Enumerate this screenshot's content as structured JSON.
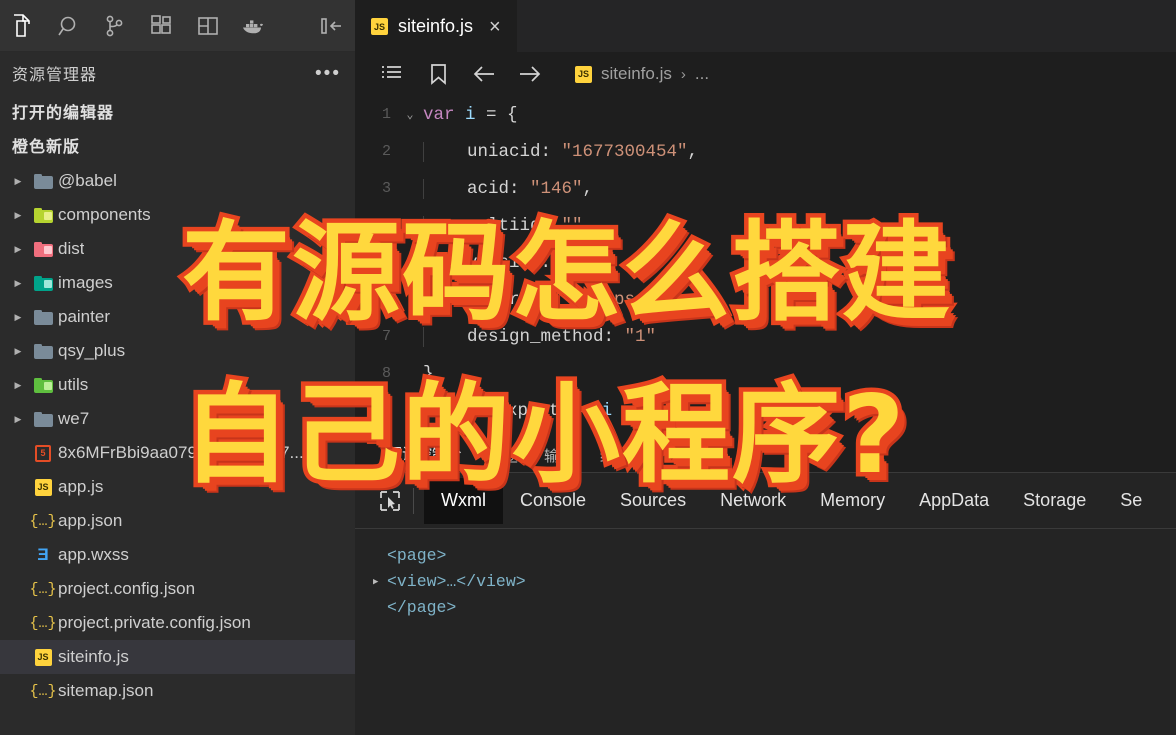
{
  "activitybar": {
    "icons": [
      {
        "name": "explorer-icon",
        "label": "资源管理器",
        "active": true
      },
      {
        "name": "search-icon",
        "label": "搜索",
        "active": false
      },
      {
        "name": "source-control-icon",
        "label": "源代码管理",
        "active": false
      },
      {
        "name": "extensions-icon",
        "label": "扩展",
        "active": false
      },
      {
        "name": "layout-split-icon",
        "label": "布局",
        "active": false
      },
      {
        "name": "docker-icon",
        "label": "Docker",
        "active": false
      },
      {
        "name": "collapse-panel-icon",
        "label": "折叠侧边栏",
        "active": false
      }
    ]
  },
  "sidebar": {
    "title": "资源管理器",
    "more_label": "•••",
    "sections": [
      {
        "label": "打开的编辑器"
      },
      {
        "label": "橙色新版"
      }
    ],
    "tree": [
      {
        "label": "@babel",
        "type": "folder",
        "color": "#7a8b99",
        "badge": "",
        "expandable": true
      },
      {
        "label": "components",
        "type": "folder",
        "color": "#b6d430",
        "badge": "#e8f08a",
        "expandable": true
      },
      {
        "label": "dist",
        "type": "folder",
        "color": "#f06f7e",
        "badge": "#ffc9d0",
        "expandable": true
      },
      {
        "label": "images",
        "type": "folder",
        "color": "#00a38a",
        "badge": "#9fe8da",
        "expandable": true
      },
      {
        "label": "painter",
        "type": "folder",
        "color": "#7a8b99",
        "badge": "",
        "expandable": true
      },
      {
        "label": "qsy_plus",
        "type": "folder",
        "color": "#7a8b99",
        "badge": "",
        "expandable": true
      },
      {
        "label": "utils",
        "type": "folder",
        "color": "#5fbf3f",
        "badge": "#bdf09a",
        "expandable": true
      },
      {
        "label": "we7",
        "type": "folder",
        "color": "#7a8b99",
        "badge": "",
        "expandable": true
      },
      {
        "label": "8x6MFrBbi9aa079be7219c1c7...",
        "type": "html",
        "expandable": false
      },
      {
        "label": "app.js",
        "type": "js",
        "expandable": false
      },
      {
        "label": "app.json",
        "type": "json",
        "expandable": false
      },
      {
        "label": "app.wxss",
        "type": "css",
        "expandable": false
      },
      {
        "label": "project.config.json",
        "type": "json",
        "expandable": false
      },
      {
        "label": "project.private.config.json",
        "type": "json",
        "expandable": false
      },
      {
        "label": "siteinfo.js",
        "type": "js",
        "expandable": false,
        "selected": true
      },
      {
        "label": "sitemap.json",
        "type": "json",
        "expandable": false
      }
    ]
  },
  "editor": {
    "tab": {
      "label": "siteinfo.js",
      "icon": "JS",
      "close": "×"
    },
    "breadcrumb": {
      "file": "siteinfo.js",
      "separator": "›",
      "ellipsis": "...",
      "outline_icon": "outline-icon",
      "bookmark_icon": "bookmark-icon",
      "back_icon": "arrow-left-icon",
      "forward_icon": "arrow-right-icon"
    },
    "lines": [
      {
        "num": "1",
        "fold": "⌄",
        "indent": 0,
        "tokens": [
          {
            "t": "var ",
            "c": "kw"
          },
          {
            "t": "i",
            "c": "var"
          },
          {
            "t": " = ",
            "c": "op"
          },
          {
            "t": "{",
            "c": "punct"
          }
        ]
      },
      {
        "num": "2",
        "fold": "",
        "indent": 1,
        "tokens": [
          {
            "t": "uniacid: ",
            "c": "prop"
          },
          {
            "t": "\"1677300454\"",
            "c": "str"
          },
          {
            "t": ",",
            "c": "punct"
          }
        ]
      },
      {
        "num": "3",
        "fold": "",
        "indent": 1,
        "tokens": [
          {
            "t": "acid: ",
            "c": "prop"
          },
          {
            "t": "\"146\"",
            "c": "str"
          },
          {
            "t": ",",
            "c": "punct"
          }
        ]
      },
      {
        "num": "4",
        "fold": "",
        "indent": 1,
        "tokens": [
          {
            "t": "multiid: ",
            "c": "prop"
          },
          {
            "t": "\"\"",
            "c": "str"
          },
          {
            "t": ",",
            "c": "punct"
          }
        ]
      },
      {
        "num": "5",
        "fold": "",
        "indent": 1,
        "tokens": [
          {
            "t": "version: ",
            "c": "prop"
          },
          {
            "t": "\"\"",
            "c": "str"
          },
          {
            "t": ",",
            "c": "punct"
          }
        ]
      },
      {
        "num": "6",
        "fold": "",
        "indent": 1,
        "tokens": [
          {
            "t": "siteroot: ",
            "c": "prop"
          },
          {
            "t": "\"https://",
            "c": "str"
          },
          {
            "t": "app",
            "c": "link"
          },
          {
            "t": "\"",
            "c": "str"
          },
          {
            "t": ",",
            "c": "punct"
          }
        ]
      },
      {
        "num": "7",
        "fold": "",
        "indent": 1,
        "tokens": [
          {
            "t": "design_method: ",
            "c": "prop"
          },
          {
            "t": "\"1\"",
            "c": "str"
          }
        ]
      },
      {
        "num": "8",
        "fold": "",
        "indent": 0,
        "tokens": [
          {
            "t": "}",
            "c": "punct"
          }
        ]
      },
      {
        "num": "9",
        "fold": "",
        "indent": 0,
        "tokens": [
          {
            "t": "module",
            "c": "var"
          },
          {
            "t": ".",
            "c": "punct"
          },
          {
            "t": "exports ",
            "c": "prop"
          },
          {
            "t": "= ",
            "c": "y"
          },
          {
            "t": "i",
            "c": "var"
          }
        ]
      }
    ]
  },
  "panelstrip": {
    "tabs": [
      {
        "label": "调试控制台",
        "active": true
      },
      {
        "label": "问题",
        "active": false
      },
      {
        "label": "输出",
        "active": false
      },
      {
        "label": "终端",
        "active": false
      }
    ]
  },
  "devtools": {
    "inspect_icon": "inspect-element-icon",
    "tabs": [
      {
        "label": "Wxml",
        "active": true
      },
      {
        "label": "Console",
        "active": false
      },
      {
        "label": "Sources",
        "active": false
      },
      {
        "label": "Network",
        "active": false
      },
      {
        "label": "Memory",
        "active": false
      },
      {
        "label": "AppData",
        "active": false
      },
      {
        "label": "Storage",
        "active": false
      },
      {
        "label": "Se",
        "active": false
      }
    ],
    "wxml": [
      {
        "arrow": "",
        "text": "<page>"
      },
      {
        "arrow": "▶",
        "text": "<view>…</view>"
      },
      {
        "arrow": "",
        "text": "</page>"
      }
    ]
  },
  "overlay": {
    "line1": "有源码怎么搭建",
    "line2": "自己的小程序?",
    "fill_color": "#ffd83d",
    "stroke_color": "#e8441f"
  }
}
